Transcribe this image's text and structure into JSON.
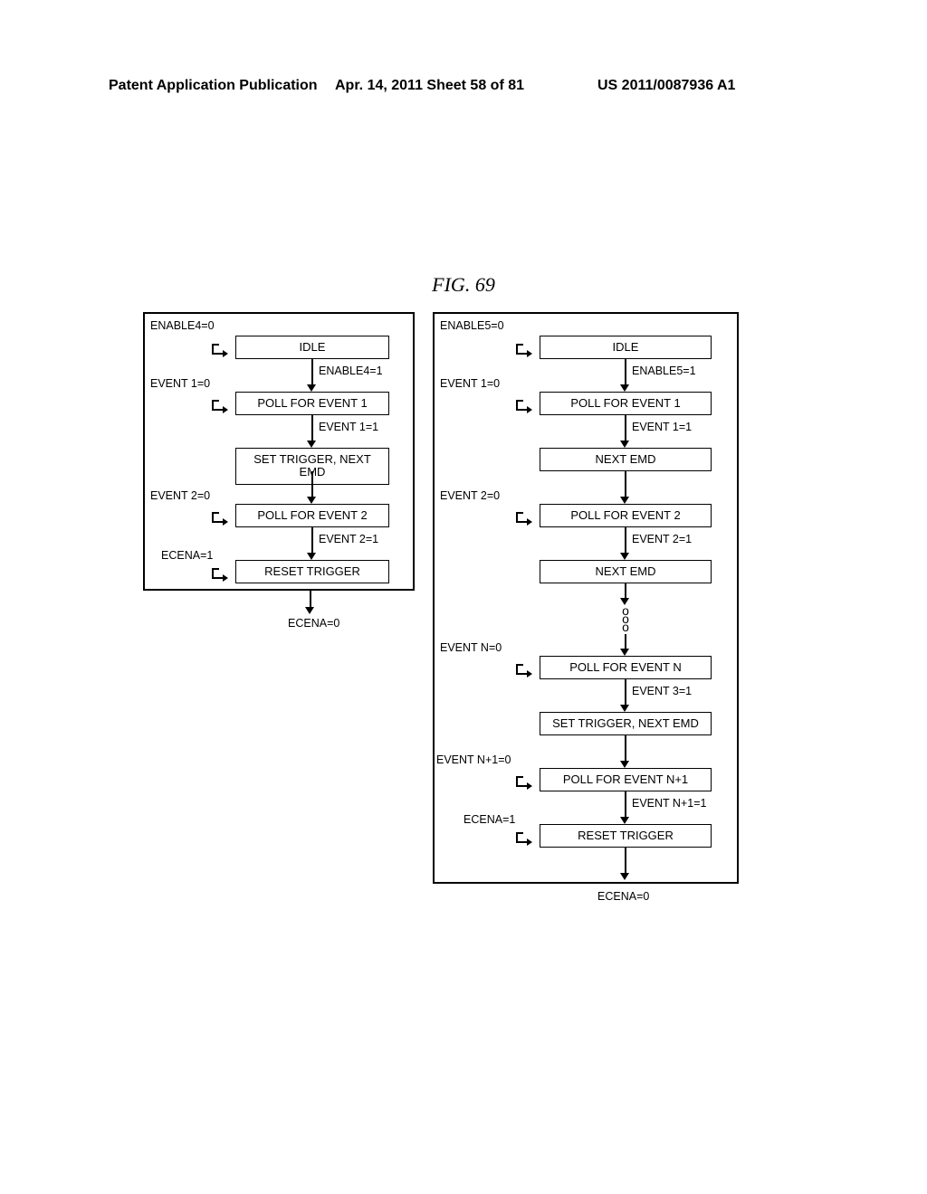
{
  "header": {
    "left": "Patent Application Publication",
    "mid": "Apr. 14, 2011  Sheet 58 of 81",
    "right": "US 2011/0087936 A1"
  },
  "figure_title": "FIG. 69",
  "left_fsm": {
    "states": {
      "idle": "IDLE",
      "poll1": "POLL FOR EVENT 1",
      "trigger": "SET TRIGGER, NEXT EMD",
      "poll2": "POLL FOR EVENT 2",
      "reset": "RESET TRIGGER"
    },
    "labels": {
      "enable4_0": "ENABLE4=0",
      "enable4_1": "ENABLE4=1",
      "event1_0": "EVENT 1=0",
      "event1_1": "EVENT 1=1",
      "event2_0": "EVENT 2=0",
      "event2_1": "EVENT 2=1",
      "ecena_1": "ECENA=1",
      "ecena_0": "ECENA=0"
    }
  },
  "right_fsm": {
    "states": {
      "idle": "IDLE",
      "poll1": "POLL FOR EVENT 1",
      "next1": "NEXT EMD",
      "poll2": "POLL FOR EVENT 2",
      "next2": "NEXT EMD",
      "pollN": "POLL FOR EVENT N",
      "trigger": "SET TRIGGER, NEXT EMD",
      "pollN1": "POLL FOR EVENT N+1",
      "reset": "RESET TRIGGER"
    },
    "labels": {
      "enable5_0": "ENABLE5=0",
      "enable5_1": "ENABLE5=1",
      "event1_0": "EVENT 1=0",
      "event1_1": "EVENT 1=1",
      "event2_0": "EVENT 2=0",
      "event2_1": "EVENT 2=1",
      "eventN_0": "EVENT N=0",
      "event3_1": "EVENT 3=1",
      "eventN1_0": "EVENT N+1=0",
      "eventN1_1": "EVENT N+1=1",
      "ecena_1": "ECENA=1",
      "ecena_0": "ECENA=0"
    }
  }
}
